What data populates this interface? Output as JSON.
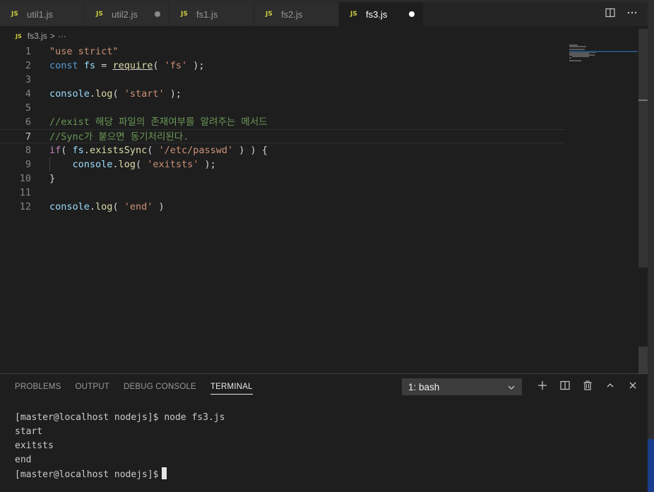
{
  "tabs": [
    {
      "label": "util1.js",
      "icon": "JS",
      "dirty": false,
      "active": false
    },
    {
      "label": "util2.js",
      "icon": "JS",
      "dirty": true,
      "active": false
    },
    {
      "label": "fs1.js",
      "icon": "JS",
      "dirty": false,
      "active": false
    },
    {
      "label": "fs2.js",
      "icon": "JS",
      "dirty": false,
      "active": false
    },
    {
      "label": "fs3.js",
      "icon": "JS",
      "dirty": true,
      "active": true
    }
  ],
  "tab_actions": {
    "split_icon": "split-editor-icon",
    "more_icon": "more-actions-icon"
  },
  "breadcrumb": {
    "icon": "JS",
    "file": "fs3.js",
    "separator": ">",
    "more": "···"
  },
  "editor": {
    "current_line": 7,
    "lines": [
      {
        "num": "1",
        "tokens": [
          {
            "t": "\"use strict\"",
            "c": "t-str"
          }
        ]
      },
      {
        "num": "2",
        "tokens": [
          {
            "t": "const",
            "c": "t-kw"
          },
          {
            "t": " ",
            "c": "t-plain"
          },
          {
            "t": "fs",
            "c": "t-var"
          },
          {
            "t": " = ",
            "c": "t-plain"
          },
          {
            "t": "require",
            "c": "t-fn underline"
          },
          {
            "t": "( ",
            "c": "t-plain"
          },
          {
            "t": "'fs'",
            "c": "t-str"
          },
          {
            "t": " );",
            "c": "t-plain"
          }
        ]
      },
      {
        "num": "3",
        "tokens": []
      },
      {
        "num": "4",
        "tokens": [
          {
            "t": "console",
            "c": "t-var"
          },
          {
            "t": ".",
            "c": "t-plain"
          },
          {
            "t": "log",
            "c": "t-fn"
          },
          {
            "t": "( ",
            "c": "t-plain"
          },
          {
            "t": "'start'",
            "c": "t-str"
          },
          {
            "t": " );",
            "c": "t-plain"
          }
        ]
      },
      {
        "num": "5",
        "tokens": []
      },
      {
        "num": "6",
        "tokens": [
          {
            "t": "//exist 해당 파일의 존재여부를 알려주는 메서드",
            "c": "t-com"
          }
        ]
      },
      {
        "num": "7",
        "tokens": [
          {
            "t": "//Sync가 붙으면 동기처리된다.",
            "c": "t-com"
          }
        ]
      },
      {
        "num": "8",
        "tokens": [
          {
            "t": "if",
            "c": "t-ctrl"
          },
          {
            "t": "( ",
            "c": "t-plain"
          },
          {
            "t": "fs",
            "c": "t-var"
          },
          {
            "t": ".",
            "c": "t-plain"
          },
          {
            "t": "existsSync",
            "c": "t-fn"
          },
          {
            "t": "( ",
            "c": "t-plain"
          },
          {
            "t": "'/etc/passwd'",
            "c": "t-str"
          },
          {
            "t": " ) ) {",
            "c": "t-plain"
          }
        ]
      },
      {
        "num": "9",
        "indent": true,
        "tokens": [
          {
            "t": "    ",
            "c": "t-plain"
          },
          {
            "t": "console",
            "c": "t-var"
          },
          {
            "t": ".",
            "c": "t-plain"
          },
          {
            "t": "log",
            "c": "t-fn"
          },
          {
            "t": "( ",
            "c": "t-plain"
          },
          {
            "t": "'exitsts'",
            "c": "t-str"
          },
          {
            "t": " );",
            "c": "t-plain"
          }
        ]
      },
      {
        "num": "10",
        "tokens": [
          {
            "t": "}",
            "c": "t-plain"
          }
        ]
      },
      {
        "num": "11",
        "tokens": []
      },
      {
        "num": "12",
        "tokens": [
          {
            "t": "console",
            "c": "t-var"
          },
          {
            "t": ".",
            "c": "t-plain"
          },
          {
            "t": "log",
            "c": "t-fn"
          },
          {
            "t": "( ",
            "c": "t-plain"
          },
          {
            "t": "'end'",
            "c": "t-str"
          },
          {
            "t": " )",
            "c": "t-plain"
          }
        ]
      }
    ]
  },
  "panel": {
    "tabs": [
      {
        "label": "PROBLEMS",
        "active": false
      },
      {
        "label": "OUTPUT",
        "active": false
      },
      {
        "label": "DEBUG CONSOLE",
        "active": false
      },
      {
        "label": "TERMINAL",
        "active": true
      }
    ],
    "terminal_select": "1: bash",
    "actions": [
      "plus-icon",
      "split-terminal-icon",
      "trash-icon",
      "chevron-up-icon",
      "close-icon"
    ],
    "terminal_lines": [
      "[master@localhost nodejs]$ node fs3.js",
      "start",
      "exitsts",
      "end"
    ],
    "prompt": "[master@localhost nodejs]$"
  },
  "colors": {
    "editor_bg": "#1e1e1e",
    "tabbar_bg": "#252526",
    "string": "#ce9178",
    "keyword": "#569cd6",
    "variable": "#9cdcfe",
    "function": "#dcdcaa",
    "comment": "#6a9955",
    "control": "#c586c0"
  }
}
